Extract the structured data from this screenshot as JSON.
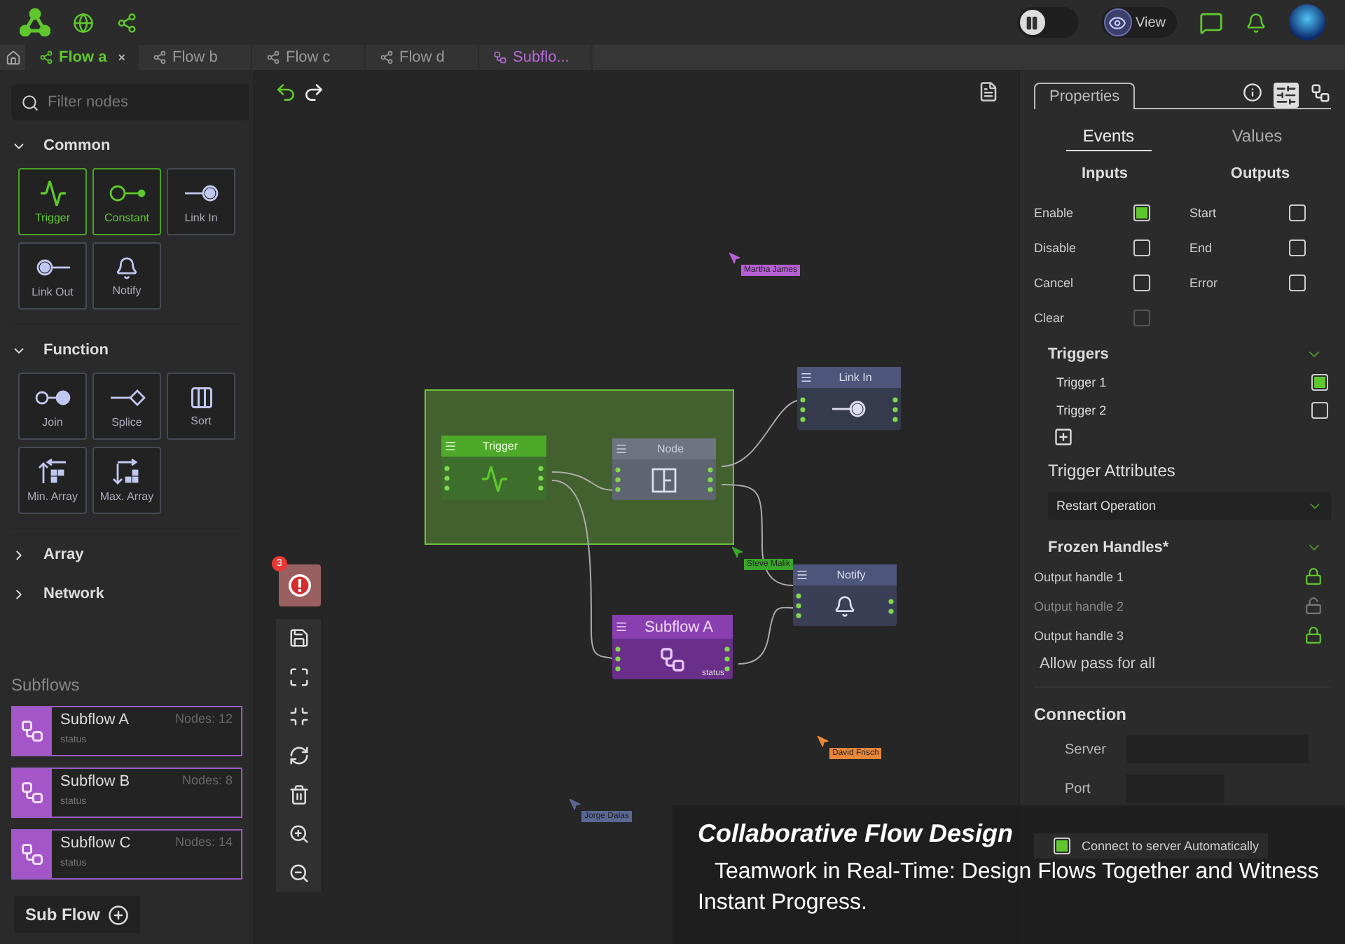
{
  "tabs": [
    {
      "label": "Flow a",
      "kind": "flow",
      "selected": true,
      "close": "×"
    },
    {
      "label": "Flow b",
      "kind": "flow",
      "selected": false
    },
    {
      "label": "Flow c",
      "kind": "flow",
      "selected": false
    },
    {
      "label": "Flow d",
      "kind": "flow",
      "selected": false
    },
    {
      "label": "Subflo...",
      "kind": "subflow",
      "selected": false
    }
  ],
  "topbar": {
    "view_label": "View",
    "on": false
  },
  "sidebar": {
    "search_placeholder": "Filter nodes",
    "categories": [
      {
        "label": "Common",
        "expanded": true,
        "nodes": [
          {
            "label": "Trigger",
            "kind": "trigger",
            "highlighted": true
          },
          {
            "label": "Constant",
            "kind": "constant",
            "highlighted": true
          },
          {
            "label": "Link In",
            "kind": "link-in",
            "highlighted": false
          },
          {
            "label": "Link Out",
            "kind": "link-out",
            "highlighted": false
          },
          {
            "label": "Notify",
            "kind": "notify",
            "highlighted": false
          }
        ]
      },
      {
        "label": "Function",
        "expanded": true,
        "nodes": [
          {
            "label": "Join",
            "kind": "join",
            "highlighted": false
          },
          {
            "label": "Splice",
            "kind": "splice",
            "highlighted": false
          },
          {
            "label": "Sort",
            "kind": "sort",
            "highlighted": false
          },
          {
            "label": "Min. Array",
            "kind": "min-array",
            "highlighted": false
          },
          {
            "label": "Max. Array",
            "kind": "max-array",
            "highlighted": false
          }
        ]
      },
      {
        "label": "Array",
        "expanded": false
      },
      {
        "label": "Network",
        "expanded": false
      }
    ],
    "subflows_title": "Subflows",
    "subflows": [
      {
        "name": "Subflow A",
        "nodes": "Nodes: 12",
        "status": "status"
      },
      {
        "name": "Subflow B",
        "nodes": "Nodes: 8",
        "status": "status"
      },
      {
        "name": "Subflow C",
        "nodes": "Nodes: 14",
        "status": "status"
      }
    ],
    "add_button": "Sub Flow"
  },
  "canvas": {
    "error_count": "3",
    "nodes": [
      {
        "title": "Trigger",
        "kind": "trigger"
      },
      {
        "title": "Node",
        "kind": "generic"
      },
      {
        "title": "Link In",
        "kind": "link-in"
      },
      {
        "title": "Notify",
        "kind": "notify"
      },
      {
        "title": "Subflow A",
        "kind": "subflow",
        "status": "status"
      }
    ],
    "cursors": [
      {
        "name": "Martha James",
        "color": "#b45fd2"
      },
      {
        "name": "Steve Malik",
        "color": "#3aa52b"
      },
      {
        "name": "David Frisch",
        "color": "#e8873a"
      },
      {
        "name": "Jorge Dalas",
        "color": "#5b6894"
      }
    ]
  },
  "properties": {
    "tab": "Properties",
    "subtabs": [
      {
        "label": "Events",
        "selected": true
      },
      {
        "label": "Values",
        "selected": false
      }
    ],
    "inputs_title": "Inputs",
    "outputs_title": "Outputs",
    "inputs": [
      {
        "label": "Enable",
        "checked": true,
        "disabled": false
      },
      {
        "label": "Disable",
        "checked": false,
        "disabled": false
      },
      {
        "label": "Cancel",
        "checked": false,
        "disabled": false
      },
      {
        "label": "Clear",
        "checked": false,
        "disabled": true
      }
    ],
    "outputs": [
      {
        "label": "Start",
        "checked": false
      },
      {
        "label": "End",
        "checked": false
      },
      {
        "label": "Error",
        "checked": false
      }
    ],
    "triggers_title": "Triggers",
    "triggers": [
      {
        "label": "Trigger 1",
        "checked": true
      },
      {
        "label": "Trigger 2",
        "checked": false
      }
    ],
    "attributes_title": "Trigger Attributes",
    "attribute_value": "Restart Operation",
    "frozen_title": "Frozen Handles*",
    "handles": [
      {
        "label": "Output handle 1",
        "locked": true
      },
      {
        "label": "Output handle 2",
        "locked": false
      },
      {
        "label": "Output handle 3",
        "locked": true
      }
    ],
    "allow_pass": "Allow pass for all",
    "connection_title": "Connection",
    "server_label": "Server",
    "port_label": "Port",
    "auto_connect": {
      "label": "Connect to server Automatically",
      "checked": true
    }
  },
  "caption": {
    "title": "Collaborative Flow Design",
    "text": "Teamwork in Real-Time: Design Flows Together and Witness Instant Progress."
  }
}
